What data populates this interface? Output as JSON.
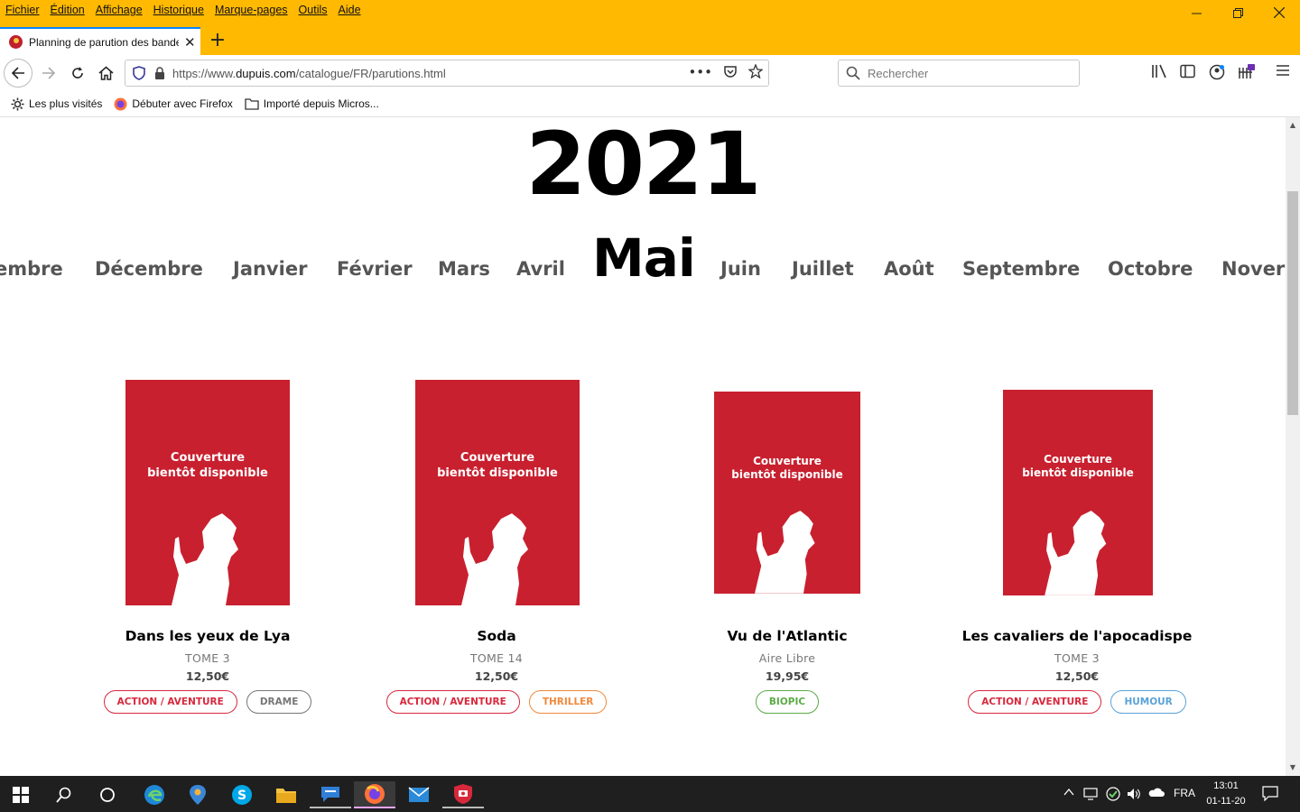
{
  "menubar": [
    "Fichier",
    "Édition",
    "Affichage",
    "Historique",
    "Marque-pages",
    "Outils",
    "Aide"
  ],
  "tab": {
    "title": "Planning de parution des bandes dessinées"
  },
  "url": {
    "prefix": "https://www.",
    "domain": "dupuis.com",
    "path": "/catalogue/FR/parutions.html"
  },
  "search": {
    "placeholder": "Rechercher"
  },
  "bookmarks": [
    "Les plus visités",
    "Débuter avec Firefox",
    "Importé depuis Micros..."
  ],
  "page": {
    "year": "2021",
    "months": [
      "embre",
      "Décembre",
      "Janvier",
      "Février",
      "Mars",
      "Avril",
      "Mai",
      "Juin",
      "Juillet",
      "Août",
      "Septembre",
      "Octobre",
      "Nover"
    ],
    "active_month": "Mai",
    "cover_placeholder": "Couverture\nbientôt disponible",
    "books": [
      {
        "title": "Dans les yeux de Lya",
        "subtitle": "TOME 3",
        "price": "12,50€",
        "tags": [
          {
            "label": "ACTION / AVENTURE",
            "color": "#d8283c"
          },
          {
            "label": "DRAME",
            "color": "#777777"
          }
        ]
      },
      {
        "title": "Soda",
        "subtitle": "TOME 14",
        "price": "12,50€",
        "tags": [
          {
            "label": "ACTION / AVENTURE",
            "color": "#d8283c"
          },
          {
            "label": "THRILLER",
            "color": "#f08a3c"
          }
        ]
      },
      {
        "title": "Vu de l'Atlantic",
        "subtitle": "Aire Libre",
        "price": "19,95€",
        "tags": [
          {
            "label": "BIOPIC",
            "color": "#5aab46"
          }
        ]
      },
      {
        "title": "Les cavaliers de l'apocadispe",
        "subtitle": "TOME 3",
        "price": "12,50€",
        "tags": [
          {
            "label": "ACTION / AVENTURE",
            "color": "#d8283c"
          },
          {
            "label": "HUMOUR",
            "color": "#5aa3d8"
          }
        ]
      }
    ]
  },
  "taskbar": {
    "language": "FRA",
    "time": "13:01",
    "date": "01-11-20"
  },
  "colors": {
    "titlebar": "#ffb900",
    "cover": "#c8202f"
  }
}
